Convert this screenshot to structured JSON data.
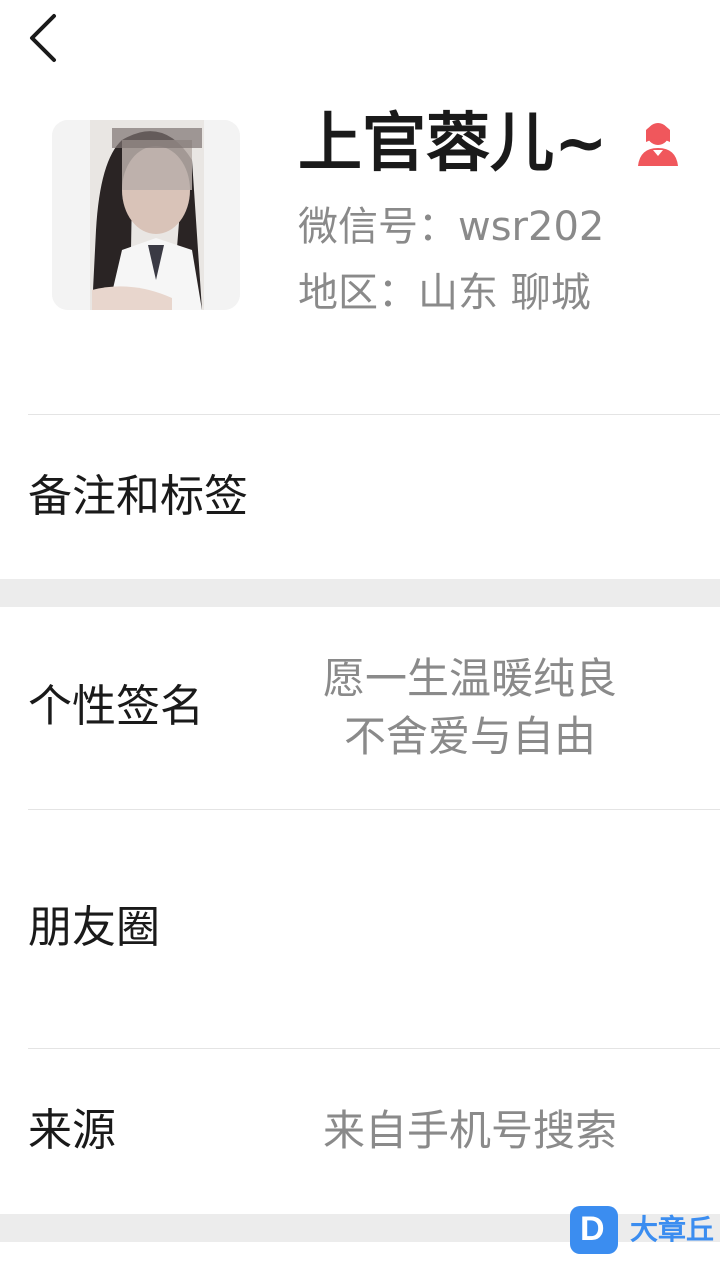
{
  "profile": {
    "name": "上官蓉儿~",
    "wechat_id": "微信号：wsr202",
    "region": "地区：山东 聊城",
    "gender_icon": "female-user-icon",
    "gender_color": "#f0575c"
  },
  "rows": {
    "remark_tags": {
      "label": "备注和标签"
    },
    "signature": {
      "label": "个性签名",
      "line1": "愿一生温暖纯良",
      "line2": "不舍爱与自由"
    },
    "moments": {
      "label": "朋友圈"
    },
    "source": {
      "label": "来源",
      "value": "来自手机号搜索"
    }
  },
  "watermark": {
    "logo_letter": "D",
    "text": "大章丘"
  },
  "icons": {
    "back": "back-arrow-icon"
  },
  "colors": {
    "section_gap": "#ececec",
    "secondary_text": "#8a8a8a",
    "watermark": "#3b8df0"
  }
}
